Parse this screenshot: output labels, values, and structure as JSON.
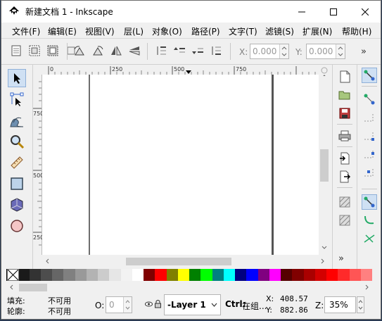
{
  "window": {
    "title": "新建文档 1 - Inkscape",
    "minimize_label": "minimize",
    "maximize_label": "maximize",
    "close_label": "close"
  },
  "menu": [
    {
      "label": "文件(F)"
    },
    {
      "label": "编辑(E)"
    },
    {
      "label": "视图(V)"
    },
    {
      "label": "层(L)"
    },
    {
      "label": "对象(O)"
    },
    {
      "label": "路径(P)"
    },
    {
      "label": "文字(T)"
    },
    {
      "label": "滤镜(S)"
    },
    {
      "label": "扩展(N)"
    },
    {
      "label": "帮助(H)"
    }
  ],
  "toolbar": {
    "x_label": "X:",
    "x_value": "0.000",
    "y_label": "Y:",
    "y_value": "0.000",
    "more": "»"
  },
  "ruler": {
    "h_labels": [
      "0",
      "250",
      "500",
      "750"
    ],
    "v_labels": [
      "750",
      "500",
      "250"
    ]
  },
  "tools": [
    {
      "icon": "selector-arrow-icon"
    },
    {
      "icon": "node-edit-icon"
    },
    {
      "icon": "tweak-icon"
    },
    {
      "icon": "zoom-icon"
    },
    {
      "icon": "measure-icon"
    },
    {
      "icon": "rectangle-icon"
    },
    {
      "icon": "3d-box-icon"
    },
    {
      "icon": "ellipse-icon"
    }
  ],
  "palette": {
    "colors": [
      "#000000",
      "#1a1a1a",
      "#333333",
      "#4d4d4d",
      "#666666",
      "#808080",
      "#999999",
      "#b3b3b3",
      "#cccccc",
      "#e6e6e6",
      "#f2f2f2",
      "#ffffff",
      "#800000",
      "#ff0000",
      "#808000",
      "#ffff00",
      "#008000",
      "#00ff00",
      "#008080",
      "#00ffff",
      "#000080",
      "#0000ff",
      "#800080",
      "#ff00ff",
      "#550000",
      "#800000",
      "#aa0000",
      "#d40000",
      "#ff0000",
      "#ff2a2a",
      "#ff5555",
      "#ff8080"
    ]
  },
  "status": {
    "fill_label": "填充:",
    "fill_value": "不可用",
    "stroke_label": "轮廓:",
    "stroke_value": "不可用",
    "opacity_label": "O:",
    "opacity_value": "0",
    "layer_name": "-Layer 1",
    "message_bold": "Ctrl:",
    "message": "在组...",
    "x_label": "X:",
    "x_value": "408.57",
    "y_label": "Y:",
    "y_value": "882.86",
    "zoom_label": "Z:",
    "zoom_value": "35%"
  }
}
